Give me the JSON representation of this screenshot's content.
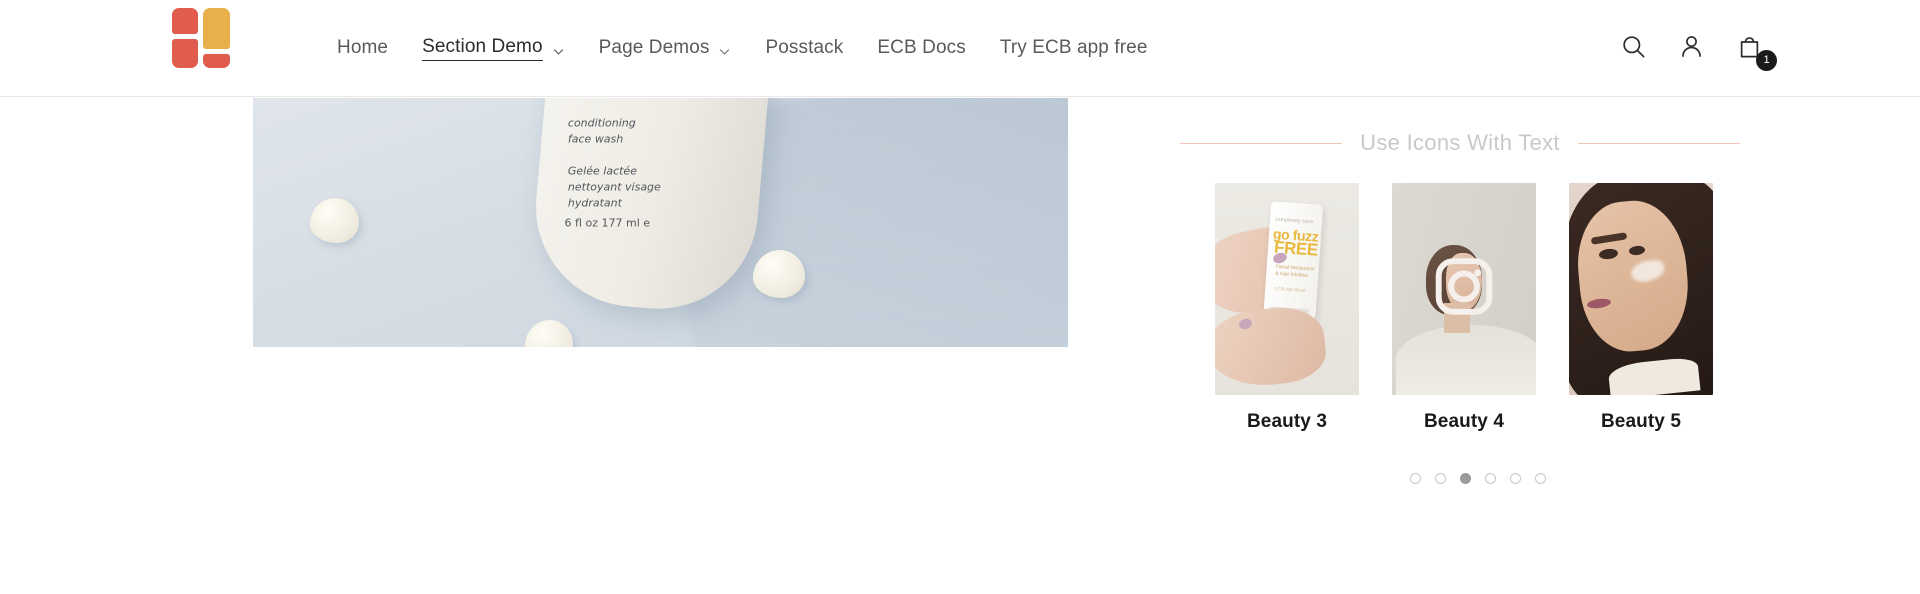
{
  "header": {
    "logo_name": "ecb-logo",
    "nav": [
      {
        "label": "Home",
        "has_dropdown": false,
        "active": false
      },
      {
        "label": "Section Demo",
        "has_dropdown": true,
        "active": true
      },
      {
        "label": "Page Demos",
        "has_dropdown": true,
        "active": false
      },
      {
        "label": "Posstack",
        "has_dropdown": false,
        "active": false
      },
      {
        "label": "ECB Docs",
        "has_dropdown": false,
        "active": false
      },
      {
        "label": "Try ECB app free",
        "has_dropdown": false,
        "active": false
      }
    ],
    "actions": {
      "search_icon": "search-icon",
      "account_icon": "account-icon",
      "cart_icon": "shopping-bag-icon",
      "cart_count": "1"
    }
  },
  "hero": {
    "image_name": "conditioning-face-wash-bottle",
    "bottle_text": "conditioning\nface wash\n\nGelée lactée\nnettoyant visage\nhydratant",
    "bottle_volume": "6 fl oz  177 ml  e"
  },
  "section": {
    "heading": "Use Icons With Text",
    "rule_color": "#f0c5b8",
    "heading_color": "#c9c9c9",
    "cards": [
      {
        "title": "Beauty 3",
        "image_name": "hand-holding-go-fuzz-free-tube",
        "icon": null,
        "tube": {
          "brand": "completely bare",
          "line1": "go fuzz",
          "line2": "FREE",
          "sub": "Facial Moisturizer\n& Hair Inhibitor",
          "size": "1.7 FL OZ / 50 ml"
        }
      },
      {
        "title": "Beauty 4",
        "image_name": "woman-in-mirror",
        "icon": "instagram-icon"
      },
      {
        "title": "Beauty 5",
        "image_name": "woman-applying-cream-to-cheek",
        "icon": null
      }
    ],
    "pagination": {
      "total": 6,
      "active_index": 2
    }
  }
}
